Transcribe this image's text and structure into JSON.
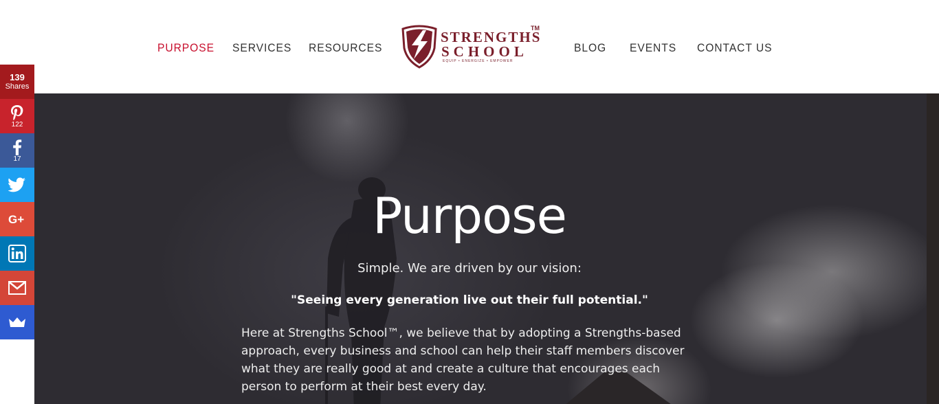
{
  "nav": {
    "left": [
      "PURPOSE",
      "SERVICES",
      "RESOURCES"
    ],
    "right": [
      "BLOG",
      "EVENTS",
      "CONTACT US"
    ],
    "active": "PURPOSE"
  },
  "logo": {
    "line1": "STRENGTHS",
    "line2": "SCHOOL",
    "tm": "TM",
    "tagline": "EQUIP  •  ENERGIZE  •  EMPOWER"
  },
  "share": {
    "total": "139",
    "total_label": "Shares",
    "pinterest_count": "122",
    "facebook_count": "17",
    "icons": [
      "pinterest-icon",
      "facebook-icon",
      "twitter-icon",
      "google-plus-icon",
      "linkedin-icon",
      "gmail-icon",
      "sumo-crown-icon"
    ]
  },
  "hero": {
    "title": "Purpose",
    "subtitle": "Simple. We are driven by our vision:",
    "quote": "\"Seeing every generation live out their full potential.\"",
    "body": "Here at Strengths School™, we believe that by adopting a Strengths-based approach, every business and school can help their staff members discover what they are really good at and create a culture that encourages each person to perform at their best every day."
  },
  "colors": {
    "accent": "#c8102e",
    "brand": "#7a1f2b",
    "nav_text": "#333333",
    "pinterest": "#c8232c",
    "facebook": "#3b5998",
    "twitter": "#1da1f2",
    "google_plus": "#dd4b39",
    "linkedin": "#0077b5",
    "gmail": "#d44638",
    "sumo": "#2e5bd1"
  }
}
